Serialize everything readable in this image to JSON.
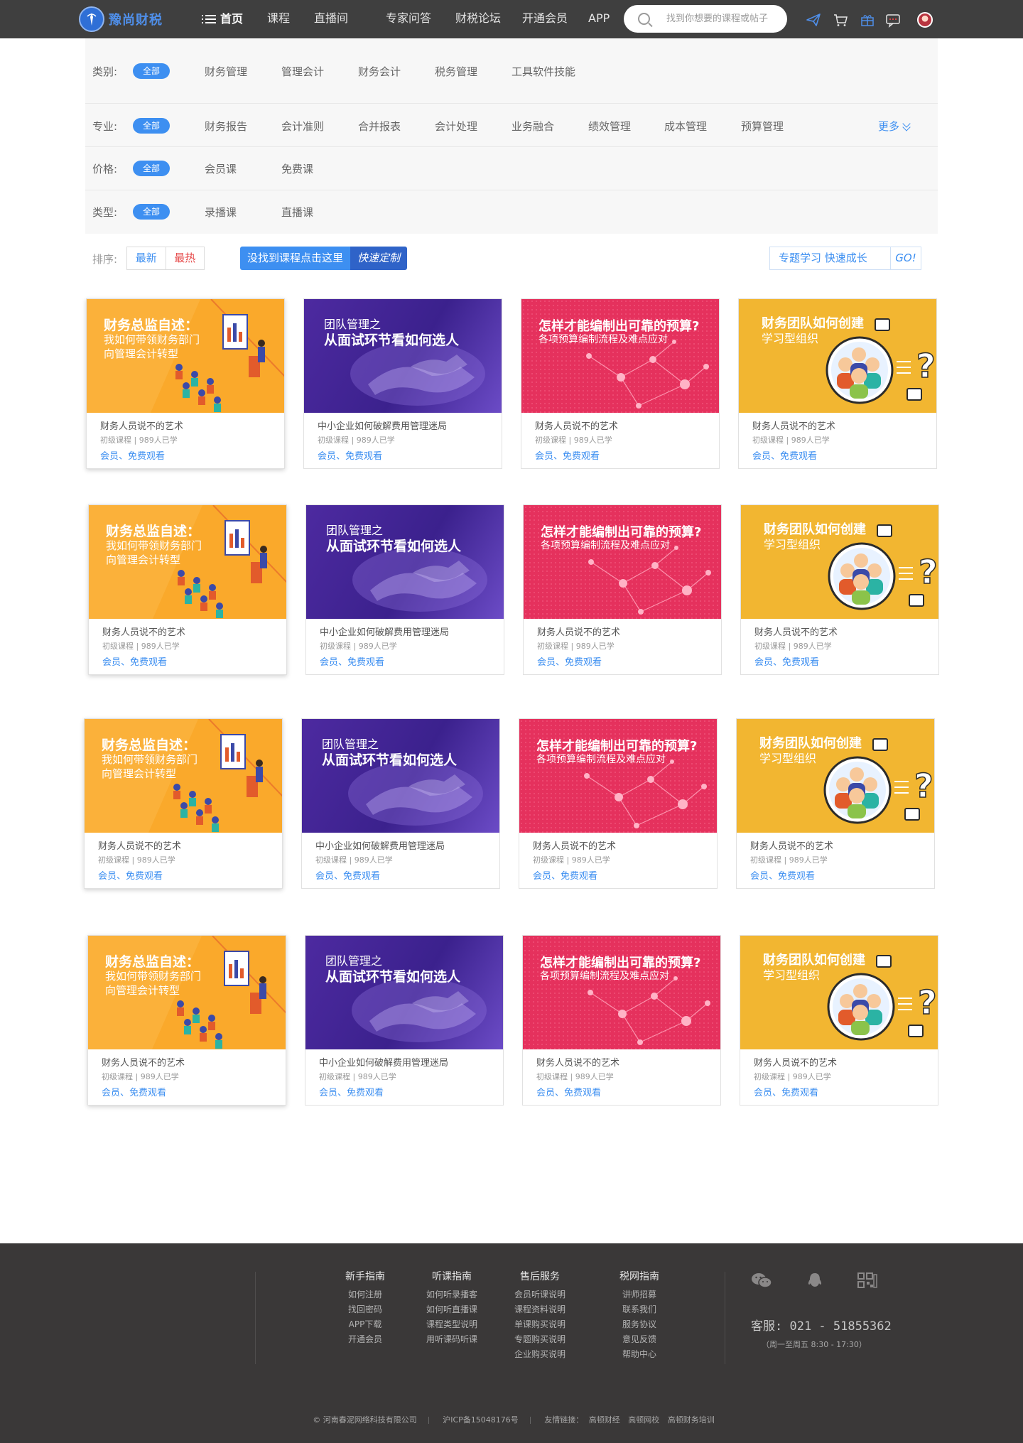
{
  "brand": {
    "name": "豫尚财税"
  },
  "nav": {
    "home": "首页",
    "items": [
      "课程",
      "直播间",
      "专家问答",
      "财税论坛",
      "开通会员",
      "APP"
    ]
  },
  "search": {
    "placeholder": "找到你想要的课程或帖子"
  },
  "filters": [
    {
      "label": "类别:",
      "all": "全部",
      "options": [
        "财务管理",
        "管理会计",
        "财务会计",
        "税务管理",
        "工具软件技能"
      ]
    },
    {
      "label": "专业:",
      "all": "全部",
      "options": [
        "财务报告",
        "会计准则",
        "合并报表",
        "会计处理",
        "业务融合",
        "绩效管理",
        "成本管理",
        "预算管理"
      ],
      "more": "更多"
    },
    {
      "label": "价格:",
      "all": "全部",
      "options": [
        "会员课",
        "免费课"
      ]
    },
    {
      "label": "类型:",
      "all": "全部",
      "options": [
        "录播课",
        "直播课"
      ]
    }
  ],
  "sort": {
    "label": "排序:",
    "newest": "最新",
    "hottest": "最热"
  },
  "custom_banner": {
    "text": "没找到课程点击这里",
    "action": "快速定制"
  },
  "topic_box": {
    "text": "专题学习  快速成长",
    "go": "GO!"
  },
  "courses": [
    {
      "theme": "orange",
      "cover_lines": [
        "财务总监自述：",
        "我如何带领财务部门",
        "向管理会计转型"
      ],
      "title": "财务人员说不的艺术",
      "meta": "初级课程 | 989人已学",
      "cta": "会员、免费观看"
    },
    {
      "theme": "purple",
      "cover_lines": [
        "团队管理之",
        "从面试环节看如何选人"
      ],
      "title": "中小企业如何破解费用管理迷局",
      "meta": "初级课程 | 989人已学",
      "cta": "会员、免费观看"
    },
    {
      "theme": "pink",
      "cover_lines": [
        "怎样才能编制出可靠的预算?",
        "各项预算编制流程及难点应对"
      ],
      "title": "财务人员说不的艺术",
      "meta": "初级课程 | 989人已学",
      "cta": "会员、免费观看"
    },
    {
      "theme": "yellow",
      "cover_lines": [
        "财务团队如何创建",
        "学习型组织"
      ],
      "title": "财务人员说不的艺术",
      "meta": "初级课程 | 989人已学",
      "cta": "会员、免费观看"
    }
  ],
  "footer": {
    "columns": [
      {
        "title": "新手指南",
        "links": [
          "如何注册",
          "找回密码",
          "APP下载",
          "开通会员"
        ]
      },
      {
        "title": "听课指南",
        "links": [
          "如何听录播客",
          "如何听直播课",
          "课程类型说明",
          "用听课码听课"
        ]
      },
      {
        "title": "售后服务",
        "links": [
          "会员听课说明",
          "课程资料说明",
          "单课购买说明",
          "专题购买说明",
          "企业购买说明"
        ]
      },
      {
        "title": "税网指南",
        "links": [
          "讲师招募",
          "联系我们",
          "服务协议",
          "意见反馈",
          "帮助中心"
        ]
      }
    ],
    "phone": "客服: 021 - 51855362",
    "hours": "（周一至周五  8:30 - 17:30）",
    "company": "© 河南春泥网络科技有限公司",
    "icp": "沪ICP备15048176号",
    "links_label": "友情链接：",
    "links": [
      "高顿财经",
      "高顿网校",
      "高顿财务培训"
    ]
  }
}
